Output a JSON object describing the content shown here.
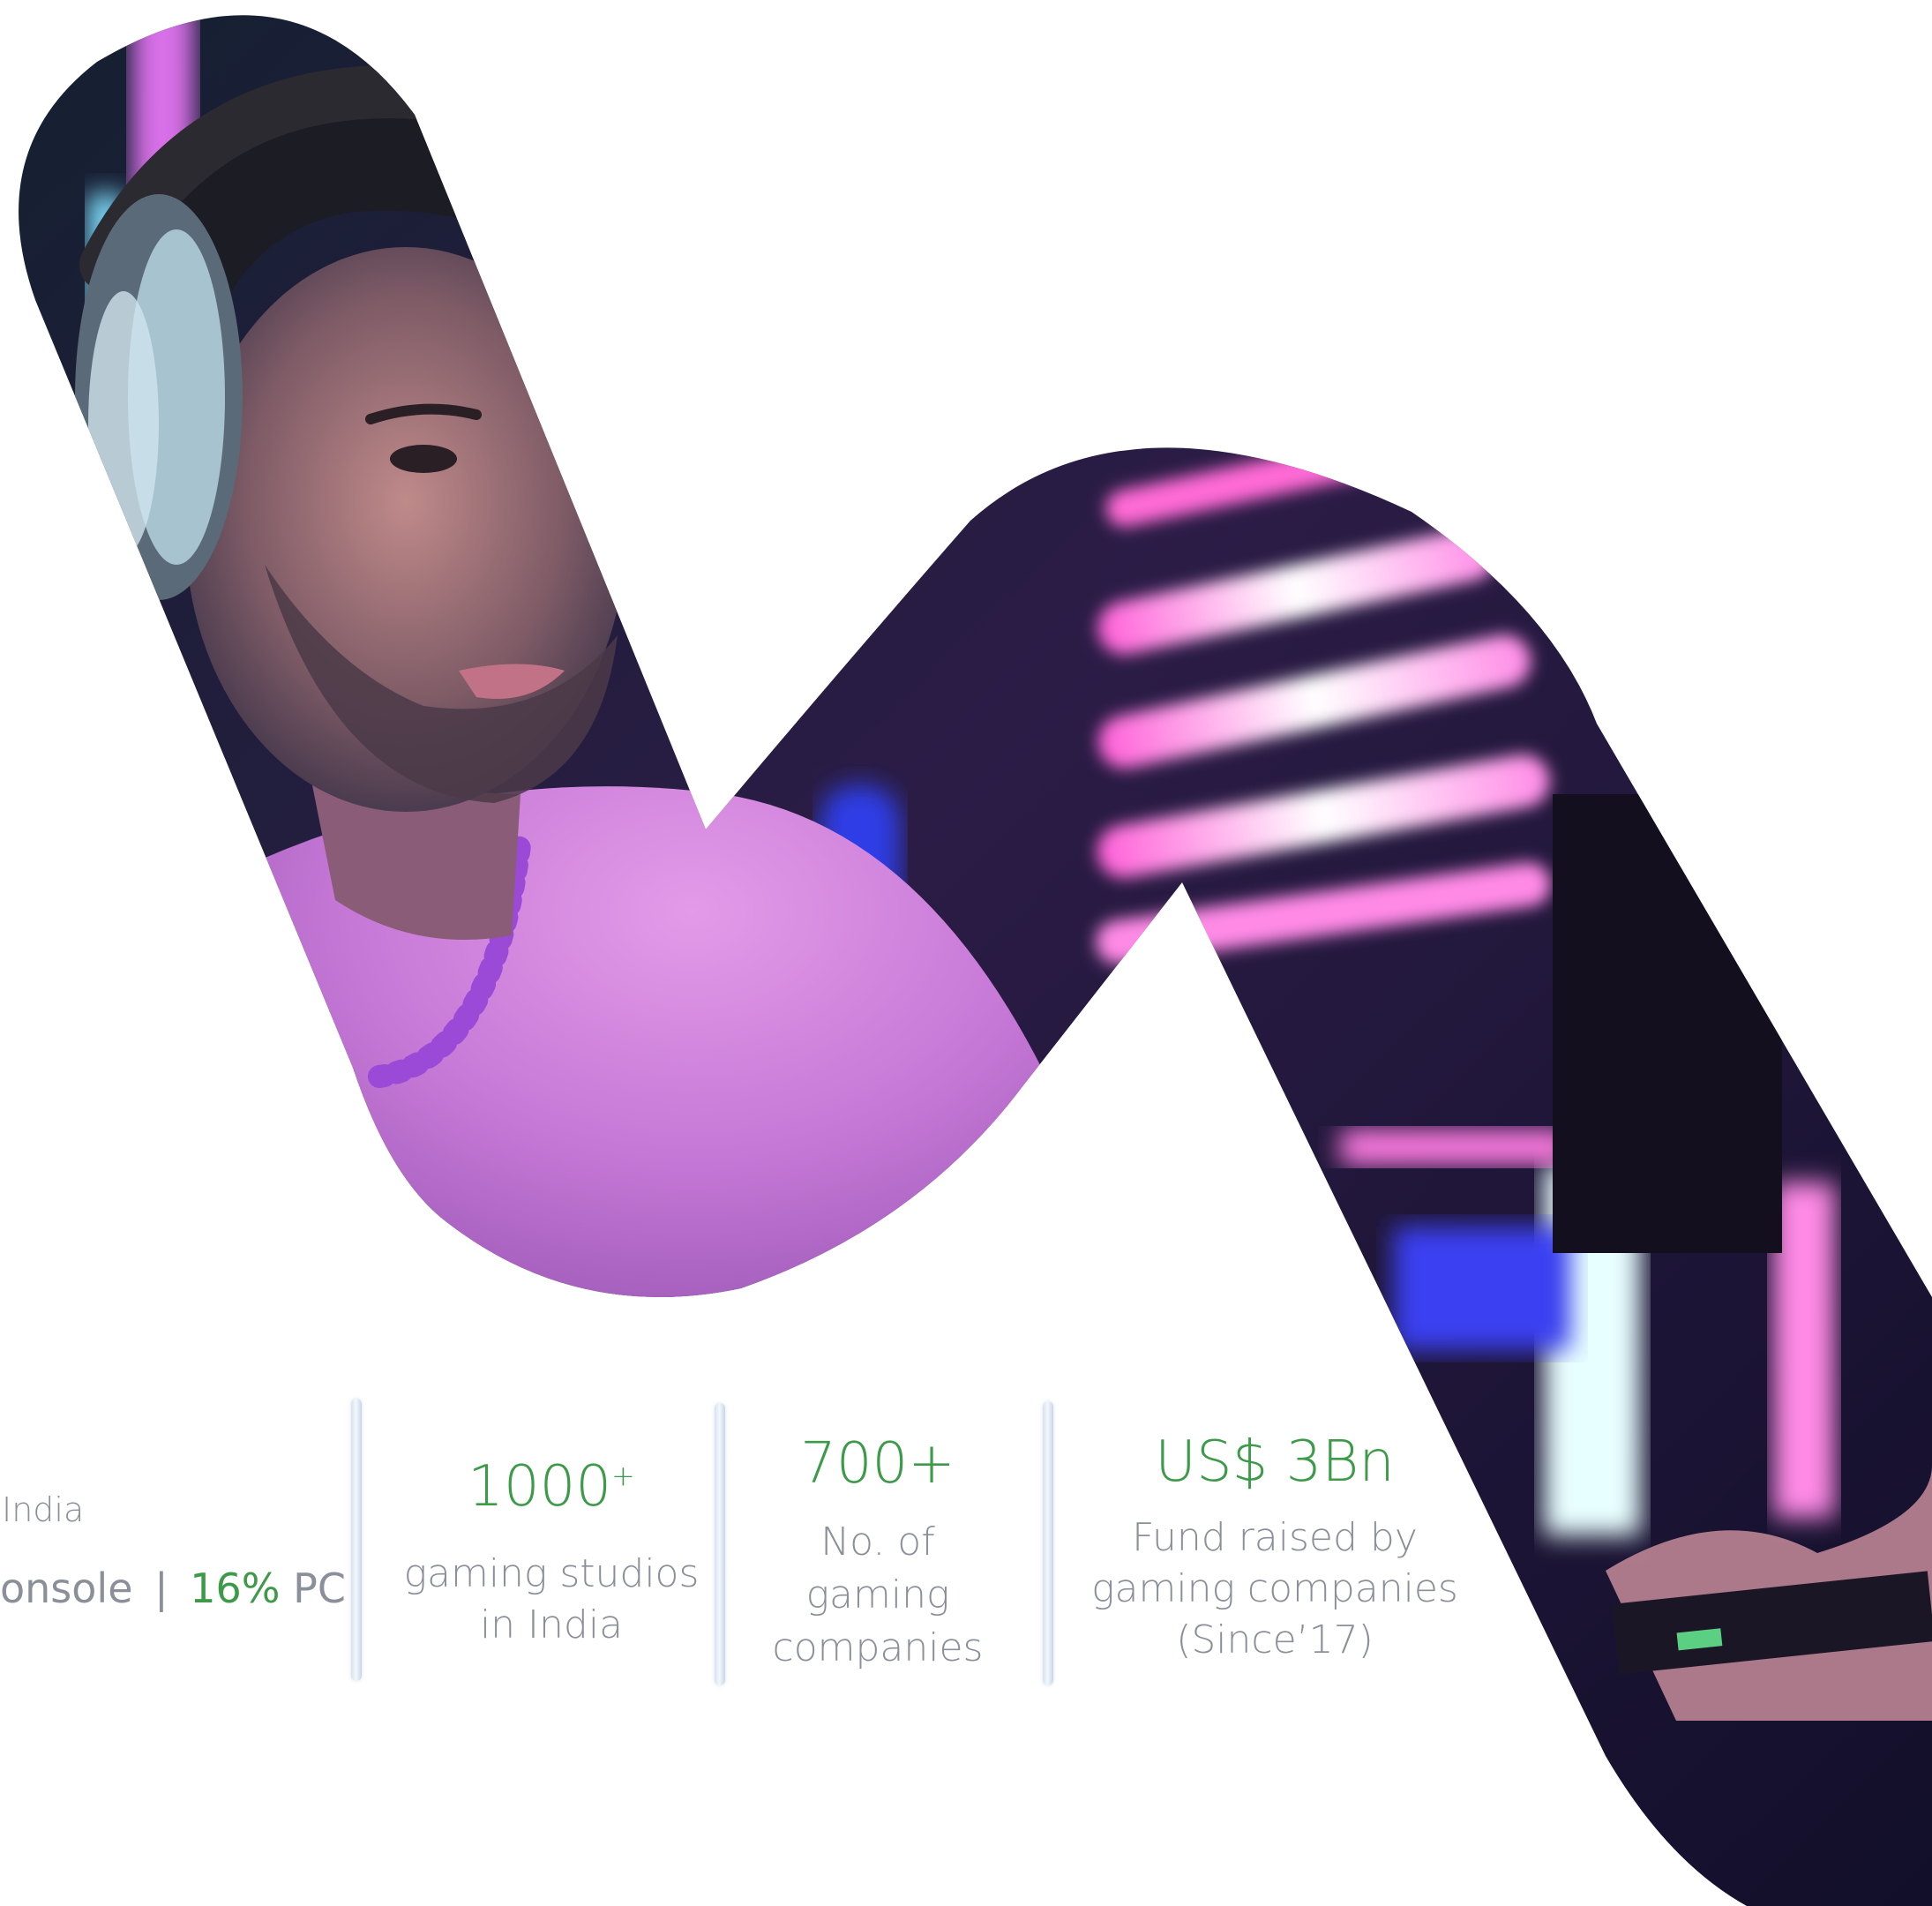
{
  "partial_stat": {
    "caption_fragment": "India",
    "split_console_fragment": "onsole",
    "separator": "|",
    "pc_value": "16%",
    "pc_label": "PC"
  },
  "stats": [
    {
      "value": "1000",
      "value_sup": "+",
      "description_lines": [
        "gaming studios",
        "in India"
      ]
    },
    {
      "value": "700+",
      "description_lines": [
        "No. of",
        "gaming",
        "companies"
      ]
    },
    {
      "value": "US$ 3Bn",
      "description_lines": [
        "Fund raised by",
        "gaming companies",
        "(Since’17)"
      ]
    }
  ],
  "colors": {
    "accent_green": "#3d9a49",
    "text_grey": "#8a8f99",
    "divider": "#c8d6e8",
    "image_pink": "#d46ee0",
    "image_navy": "#1a1e44",
    "image_purple": "#6a44a0",
    "neon_blue": "#2f3de6"
  },
  "image": {
    "subject": "gamer-with-headphones-photo",
    "shape": "w-shaped-cutout"
  }
}
